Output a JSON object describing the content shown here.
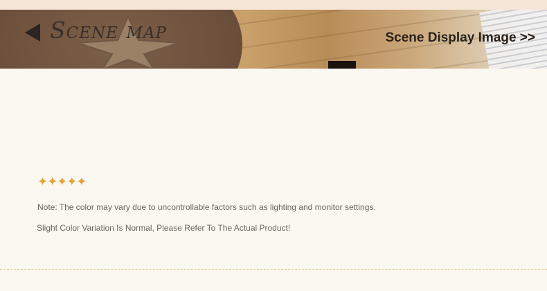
{
  "banner": {
    "title": "Scene map",
    "link_label": "Scene Display Image >>"
  },
  "decor": {
    "stars": "✦✦✦✦✦",
    "star_color": "#e3a33c"
  },
  "notes": {
    "line1": "Note: The color may vary due to uncontrollable factors such as lighting and monitor settings.",
    "line2": "Slight Color Variation Is Normal, Please Refer To The Actual Product!"
  },
  "icons": {
    "back": "left-triangle-arrow-icon",
    "star_rug": "star-icon"
  }
}
